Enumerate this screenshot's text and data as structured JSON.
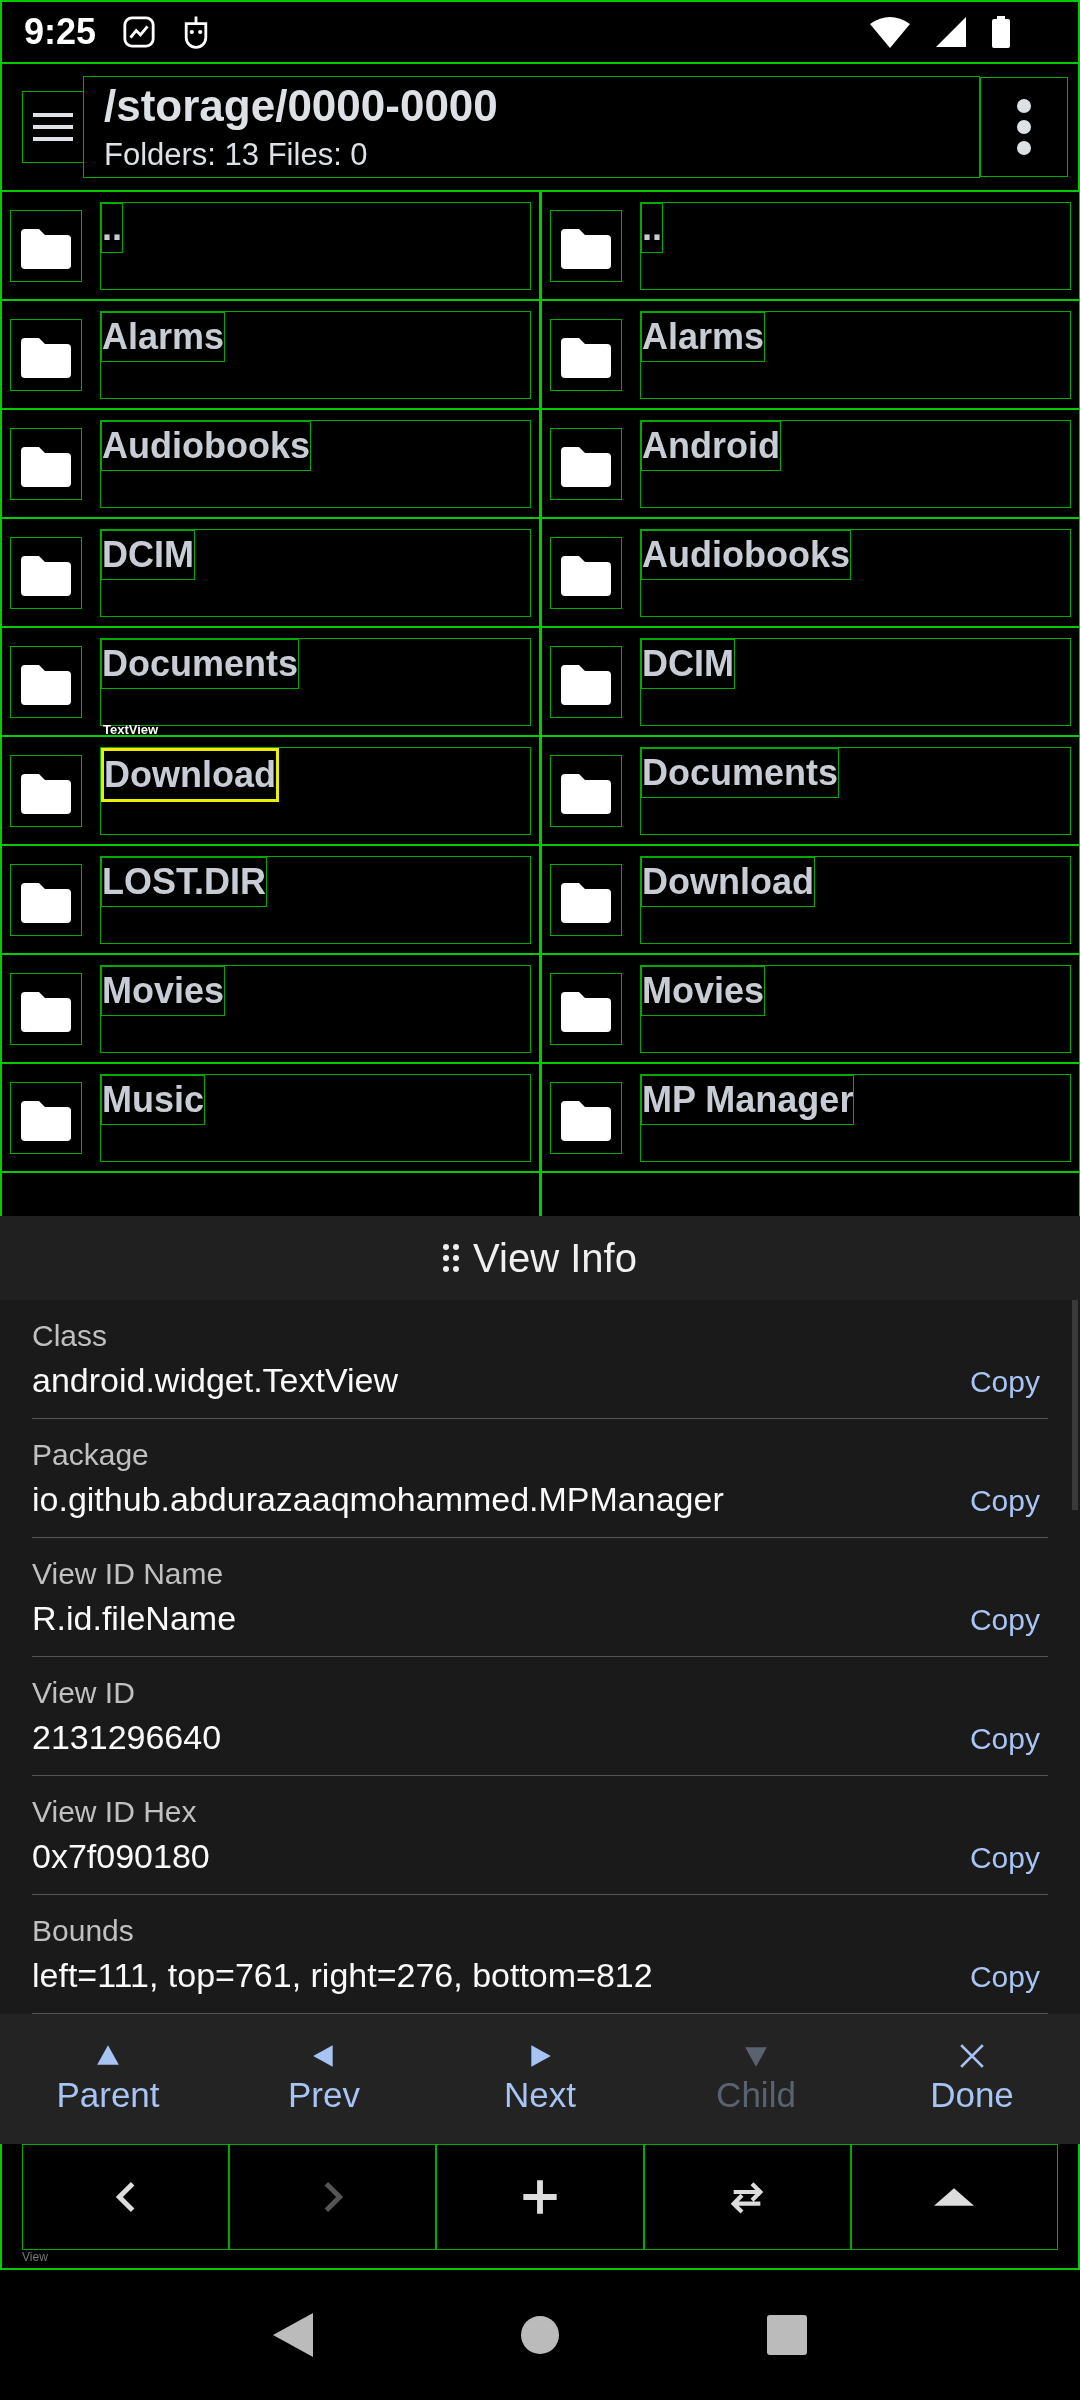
{
  "status_bar": {
    "time": "9:25"
  },
  "header": {
    "path": "/storage/0000-0000",
    "summary": "Folders: 13 Files: 0"
  },
  "left_pane": {
    "items": [
      {
        "name": "..",
        "selected": false
      },
      {
        "name": "Alarms",
        "selected": false
      },
      {
        "name": "Audiobooks",
        "selected": false
      },
      {
        "name": "DCIM",
        "selected": false
      },
      {
        "name": "Documents",
        "selected": false
      },
      {
        "name": "Download",
        "selected": true
      },
      {
        "name": "LOST.DIR",
        "selected": false
      },
      {
        "name": "Movies",
        "selected": false
      },
      {
        "name": "Music",
        "selected": false
      }
    ]
  },
  "right_pane": {
    "items": [
      {
        "name": "..",
        "selected": false
      },
      {
        "name": "Alarms",
        "selected": false
      },
      {
        "name": "Android",
        "selected": false
      },
      {
        "name": "Audiobooks",
        "selected": false
      },
      {
        "name": "DCIM",
        "selected": false
      },
      {
        "name": "Documents",
        "selected": false
      },
      {
        "name": "Download",
        "selected": false
      },
      {
        "name": "Movies",
        "selected": false
      },
      {
        "name": "MP Manager",
        "selected": false
      }
    ]
  },
  "selection_label": "TextView",
  "view_info": {
    "title": "View Info",
    "fields": [
      {
        "label": "Class",
        "value": "android.widget.TextView",
        "copy": "Copy"
      },
      {
        "label": "Package",
        "value": "io.github.abdurazaaqmohammed.MPManager",
        "copy": "Copy"
      },
      {
        "label": "View ID Name",
        "value": "R.id.fileName",
        "copy": "Copy"
      },
      {
        "label": "View ID",
        "value": "2131296640",
        "copy": "Copy"
      },
      {
        "label": "View ID Hex",
        "value": "0x7f090180",
        "copy": "Copy"
      },
      {
        "label": "Bounds",
        "value": "left=111, top=761, right=276, bottom=812",
        "copy": "Copy"
      }
    ],
    "actions": [
      {
        "label": "Parent",
        "disabled": false
      },
      {
        "label": "Prev",
        "disabled": false
      },
      {
        "label": "Next",
        "disabled": false
      },
      {
        "label": "Child",
        "disabled": true
      },
      {
        "label": "Done",
        "disabled": false
      }
    ]
  },
  "toolbar": {
    "buttons": [
      {
        "disabled": false
      },
      {
        "disabled": true
      },
      {
        "disabled": false
      },
      {
        "disabled": false
      },
      {
        "disabled": false
      }
    ],
    "view_label": "View"
  }
}
